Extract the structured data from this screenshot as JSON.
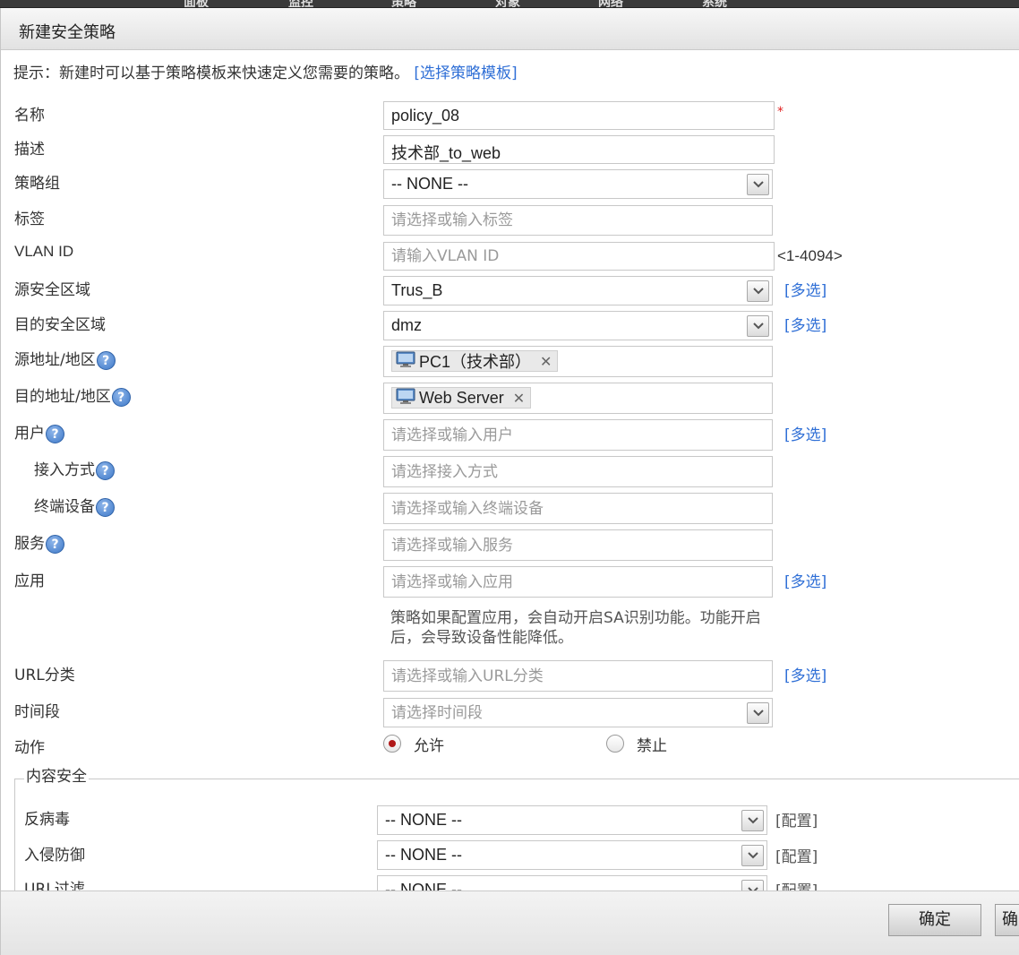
{
  "top_nav": [
    "面板",
    "监控",
    "策略",
    "对象",
    "网络",
    "系统"
  ],
  "dialog": {
    "title": "新建安全策略"
  },
  "hint": {
    "text": "提示：新建时可以基于策略模板来快速定义您需要的策略。",
    "link": "[选择策略模板]"
  },
  "form": {
    "name": {
      "label": "名称",
      "value": "policy_08",
      "required_mark": "*"
    },
    "description": {
      "label": "描述",
      "value": "技术部_to_web"
    },
    "policy_group": {
      "label": "策略组",
      "value": "-- NONE --"
    },
    "tags": {
      "label": "标签",
      "placeholder": "请选择或输入标签"
    },
    "vlan_id": {
      "label": "VLAN ID",
      "placeholder": "请输入VLAN ID",
      "range": "<1-4094>"
    },
    "src_zone": {
      "label": "源安全区域",
      "value": "Trus_B",
      "multi": "[多选]"
    },
    "dst_zone": {
      "label": "目的安全区域",
      "value": "dmz",
      "multi": "[多选]"
    },
    "src_addr": {
      "label": "源地址/地区",
      "tag": "PC1（技术部）",
      "help": "?"
    },
    "dst_addr": {
      "label": "目的地址/地区",
      "tag": "Web Server",
      "help": "?"
    },
    "user": {
      "label": "用户",
      "placeholder": "请选择或输入用户",
      "multi": "[多选]",
      "help": "?"
    },
    "access": {
      "label": "接入方式",
      "placeholder": "请选择接入方式",
      "help": "?"
    },
    "terminal": {
      "label": "终端设备",
      "placeholder": "请选择或输入终端设备",
      "help": "?"
    },
    "service": {
      "label": "服务",
      "placeholder": "请选择或输入服务",
      "help": "?"
    },
    "application": {
      "label": "应用",
      "placeholder": "请选择或输入应用",
      "multi": "[多选]"
    },
    "app_note": {
      "line1": "策略如果配置应用，会自动开启SA识别功能。功能开启",
      "line2": "后，会导致设备性能降低。"
    },
    "url_category": {
      "label": "URL分类",
      "placeholder": "请选择或输入URL分类",
      "multi": "[多选]"
    },
    "time_range": {
      "label": "时间段",
      "placeholder": "请选择时间段"
    },
    "action": {
      "label": "动作",
      "allow": "允许",
      "deny": "禁止",
      "selected": "allow"
    }
  },
  "content_security": {
    "legend": "内容安全",
    "antivirus": {
      "label": "反病毒",
      "value": "-- NONE --",
      "config": "[配置]"
    },
    "ips": {
      "label": "入侵防御",
      "value": "-- NONE --",
      "config": "[配置]"
    },
    "url_filter": {
      "label": "URL过滤",
      "value": "-- NONE --",
      "config": "[配置]"
    }
  },
  "footer": {
    "ok": "确定",
    "ok2": "确"
  }
}
